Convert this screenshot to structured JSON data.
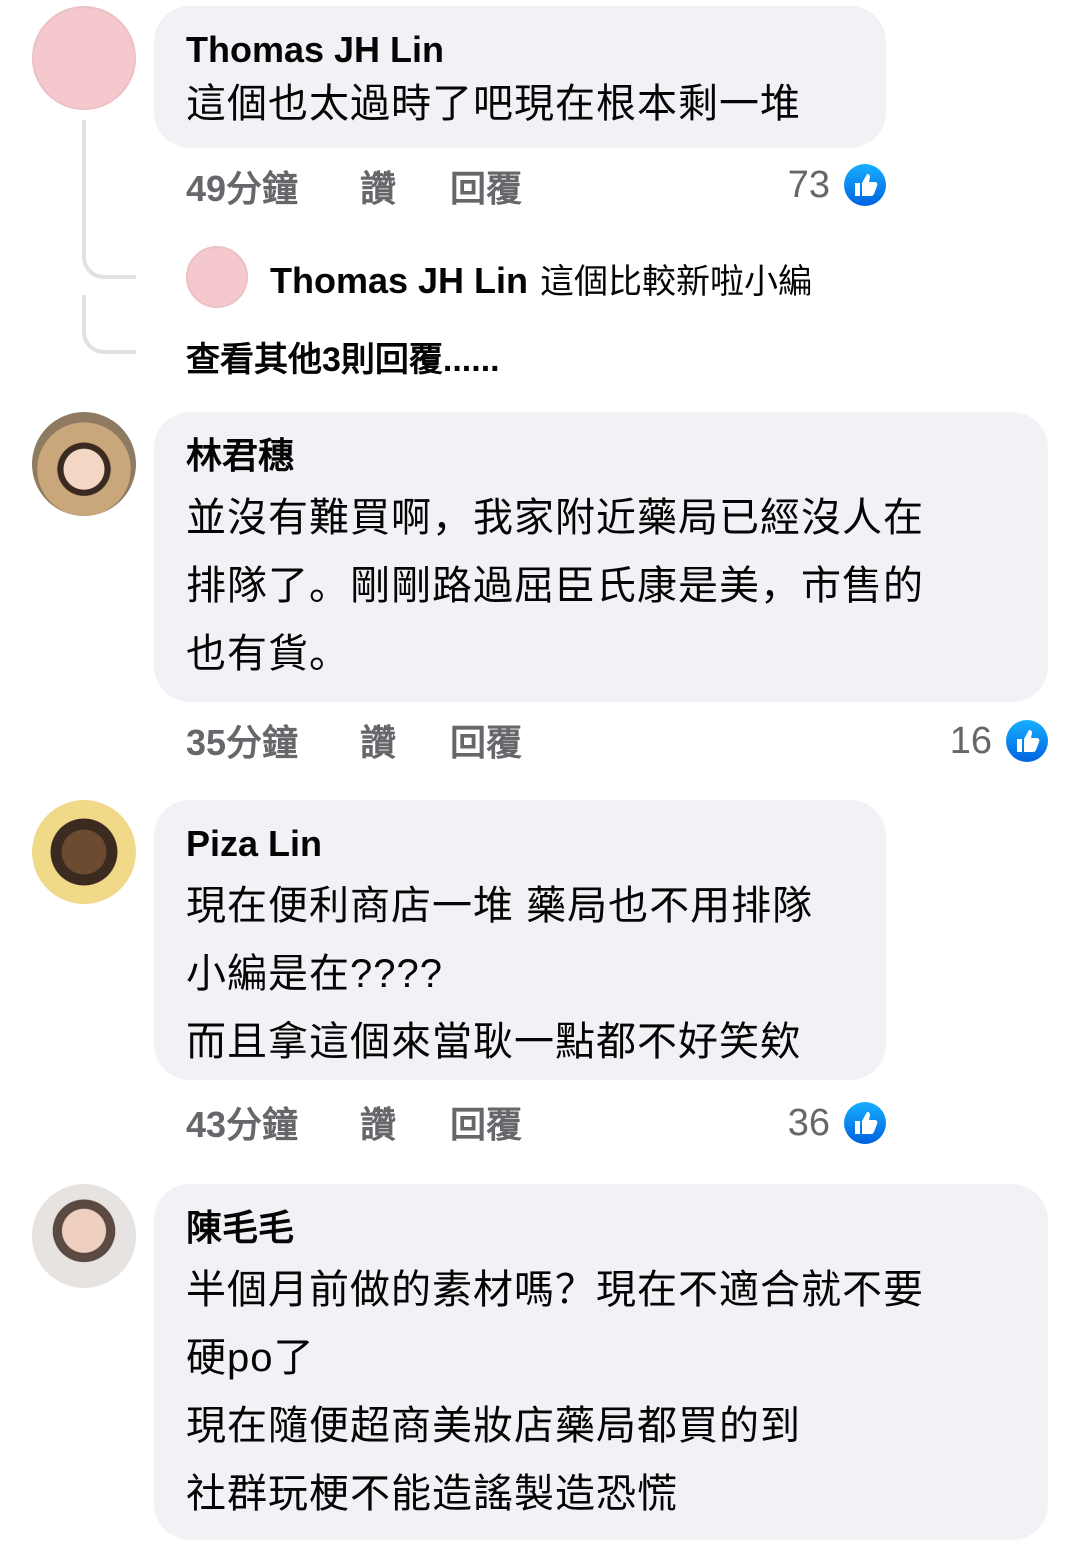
{
  "comments": [
    {
      "name": "Thomas JH Lin",
      "lines": [
        "這個也太過時了吧現在根本剩一堆"
      ],
      "time": "49分鐘",
      "like": "讚",
      "reply": "回覆",
      "reactions": "73",
      "reply_preview": {
        "name": "Thomas JH Lin",
        "text": "這個比較新啦小編"
      },
      "more_replies": "查看其他3則回覆......"
    },
    {
      "name": "林君穗",
      "lines": [
        "並沒有難買啊，我家附近藥局已經沒人在",
        "排隊了。剛剛路過屈臣氏康是美，市售的",
        "也有貨。"
      ],
      "time": "35分鐘",
      "like": "讚",
      "reply": "回覆",
      "reactions": "16"
    },
    {
      "name": "Piza Lin",
      "lines": [
        "現在便利商店一堆 藥局也不用排隊",
        "小編是在????",
        "而且拿這個來當耿一點都不好笑欸"
      ],
      "time": "43分鐘",
      "like": "讚",
      "reply": "回覆",
      "reactions": "36"
    },
    {
      "name": "陳毛毛",
      "lines": [
        "半個月前做的素材嗎？現在不適合就不要",
        "硬po了",
        "現在隨便超商美妝店藥局都買的到",
        "社群玩梗不能造謠製造恐慌"
      ]
    }
  ],
  "colors": {
    "bubble": "#f0f2f5",
    "meta": "#65676b",
    "like_blue": "#1877f2",
    "avatar_pink": "#f5c8cd"
  },
  "icons": {
    "reaction": "like-thumbs-up-icon"
  }
}
